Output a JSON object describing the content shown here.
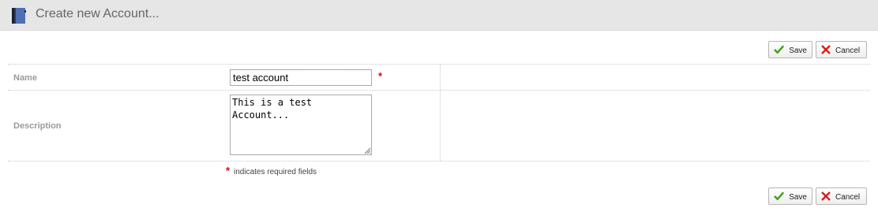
{
  "header": {
    "title": "Create new Account..."
  },
  "toolbar": {
    "save_label": "Save",
    "cancel_label": "Cancel"
  },
  "form": {
    "name_label": "Name",
    "name_value": "test account",
    "description_label": "Description",
    "description_value": "This is a test\nAccount...",
    "required_star": "*",
    "required_note": "indicates required fields"
  },
  "colors": {
    "header_bg": "#e6e6e6",
    "required": "#e00000",
    "save_icon": "#3ea012",
    "cancel_icon": "#d91c1c"
  },
  "icons": {
    "app": "address-book-icon",
    "save": "checkmark-icon",
    "cancel": "x-icon"
  }
}
